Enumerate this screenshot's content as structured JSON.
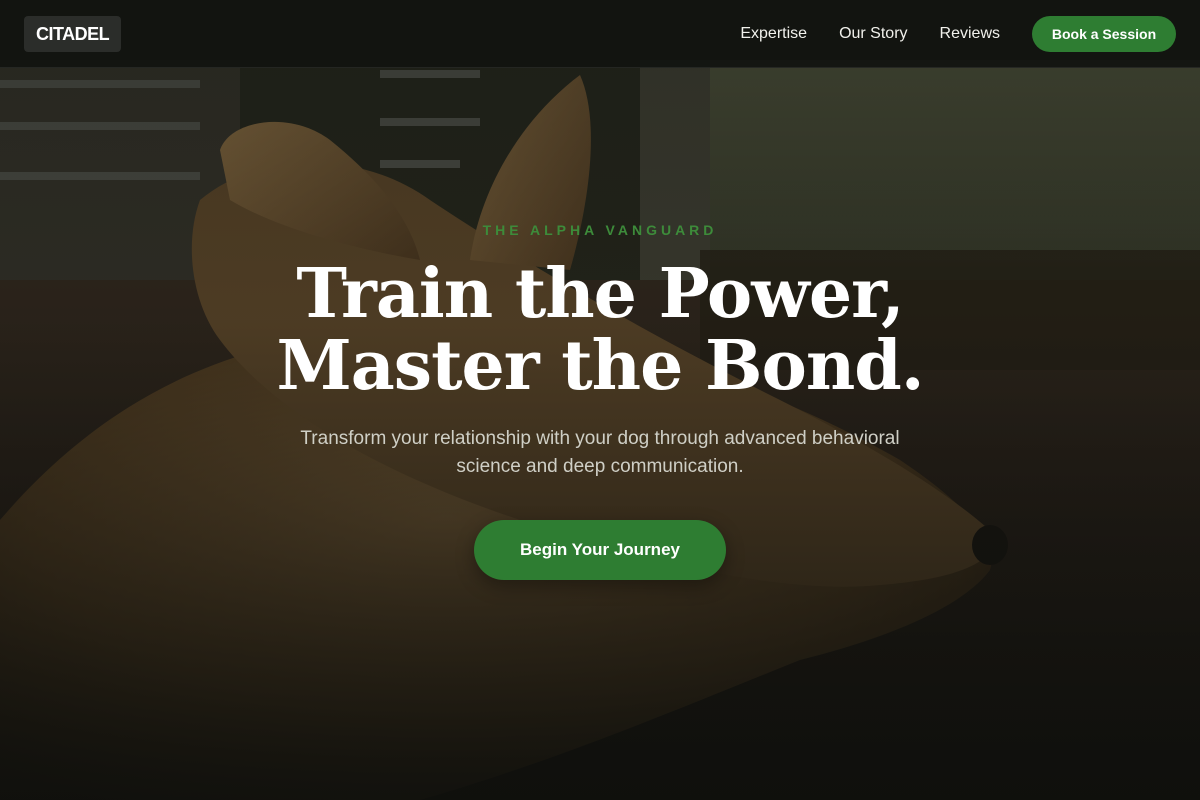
{
  "brand": {
    "logo_text": "CITADEL"
  },
  "nav": {
    "links": [
      {
        "label": "Expertise"
      },
      {
        "label": "Our Story"
      },
      {
        "label": "Reviews"
      }
    ],
    "cta_label": "Book a Session"
  },
  "hero": {
    "eyebrow": "THE ALPHA VANGUARD",
    "headline_line1": "Train the Power,",
    "headline_line2": "Master the Bond.",
    "subheadline": "Transform your relationship with your dog through advanced behavioral science and deep communication.",
    "cta_label": "Begin Your Journey",
    "background_image": "dog-photo"
  },
  "colors": {
    "accent": "#2e7d32",
    "eyebrow": "#3d8b3a",
    "nav_background": "#111310",
    "text_primary": "#ffffff"
  }
}
